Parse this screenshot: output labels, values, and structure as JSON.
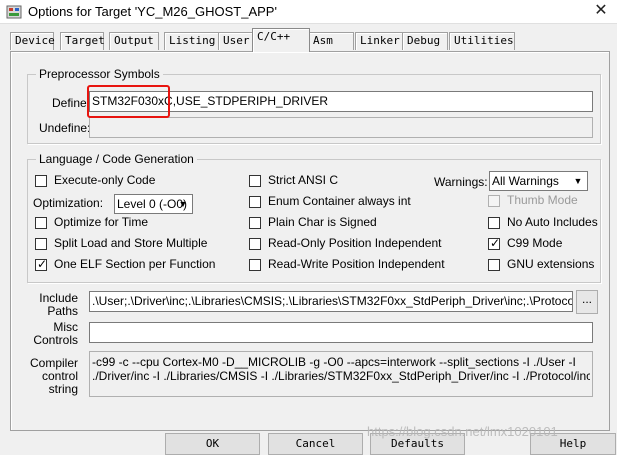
{
  "window": {
    "title": "Options for Target 'YC_M26_GHOST_APP'",
    "close_glyph": "✕"
  },
  "tabs": [
    "Device",
    "Target",
    "Output",
    "Listing",
    "User",
    "C/C++",
    "Asm",
    "Linker",
    "Debug",
    "Utilities"
  ],
  "active_tab": "C/C++",
  "preprocessor": {
    "legend": "Preprocessor Symbols",
    "define_label": "Define:",
    "define_value": "STM32F030xC,USE_STDPERIPH_DRIVER",
    "undefine_label": "Undefine:",
    "undefine_value": ""
  },
  "language": {
    "legend": "Language / Code Generation",
    "execute_only": {
      "label": "Execute-only Code",
      "checked": false
    },
    "optimization_label": "Optimization:",
    "optimization_value": "Level 0 (-O0)",
    "optimize_time": {
      "label": "Optimize for Time",
      "checked": false
    },
    "split_load": {
      "label": "Split Load and Store Multiple",
      "checked": false
    },
    "one_elf": {
      "label": "One ELF Section per Function",
      "checked": true
    },
    "strict_ansi": {
      "label": "Strict ANSI C",
      "checked": false
    },
    "enum_container": {
      "label": "Enum Container always int",
      "checked": false
    },
    "plain_char": {
      "label": "Plain Char is Signed",
      "checked": false
    },
    "ro_pos": {
      "label": "Read-Only Position Independent",
      "checked": false
    },
    "rw_pos": {
      "label": "Read-Write Position Independent",
      "checked": false
    },
    "warnings_label": "Warnings:",
    "warnings_value": "All Warnings",
    "thumb_mode": {
      "label": "Thumb Mode",
      "checked": false,
      "disabled": true
    },
    "no_auto_includes": {
      "label": "No Auto Includes",
      "checked": false
    },
    "c99_mode": {
      "label": "C99 Mode",
      "checked": true
    },
    "gnu_ext": {
      "label": "GNU extensions",
      "checked": false
    }
  },
  "include": {
    "label_line1": "Include",
    "label_line2": "Paths",
    "value": ".\\User;.\\Driver\\inc;.\\Libraries\\CMSIS;.\\Libraries\\STM32F0xx_StdPeriph_Driver\\inc;.\\Protocol\\inc;.\\L",
    "browse_label": "..."
  },
  "misc": {
    "label_line1": "Misc",
    "label_line2": "Controls",
    "value": ""
  },
  "compiler": {
    "label_line1": "Compiler",
    "label_line2": "control",
    "label_line3": "string",
    "line1": "-c99 -c --cpu Cortex-M0 -D__MICROLIB -g -O0 --apcs=interwork --split_sections -I ./User -I",
    "line2": "./Driver/inc -I ./Libraries/CMSIS -I ./Libraries/STM32F0xx_StdPeriph_Driver/inc -I ./Protocol/inc -I"
  },
  "buttons": {
    "ok": "OK",
    "cancel": "Cancel",
    "defaults": "Defaults",
    "help": "Help"
  },
  "watermark": "https://blog.csdn.net/lmx1020101",
  "colors": {
    "highlight": "#e8140f",
    "background": "#f0f0f0"
  }
}
